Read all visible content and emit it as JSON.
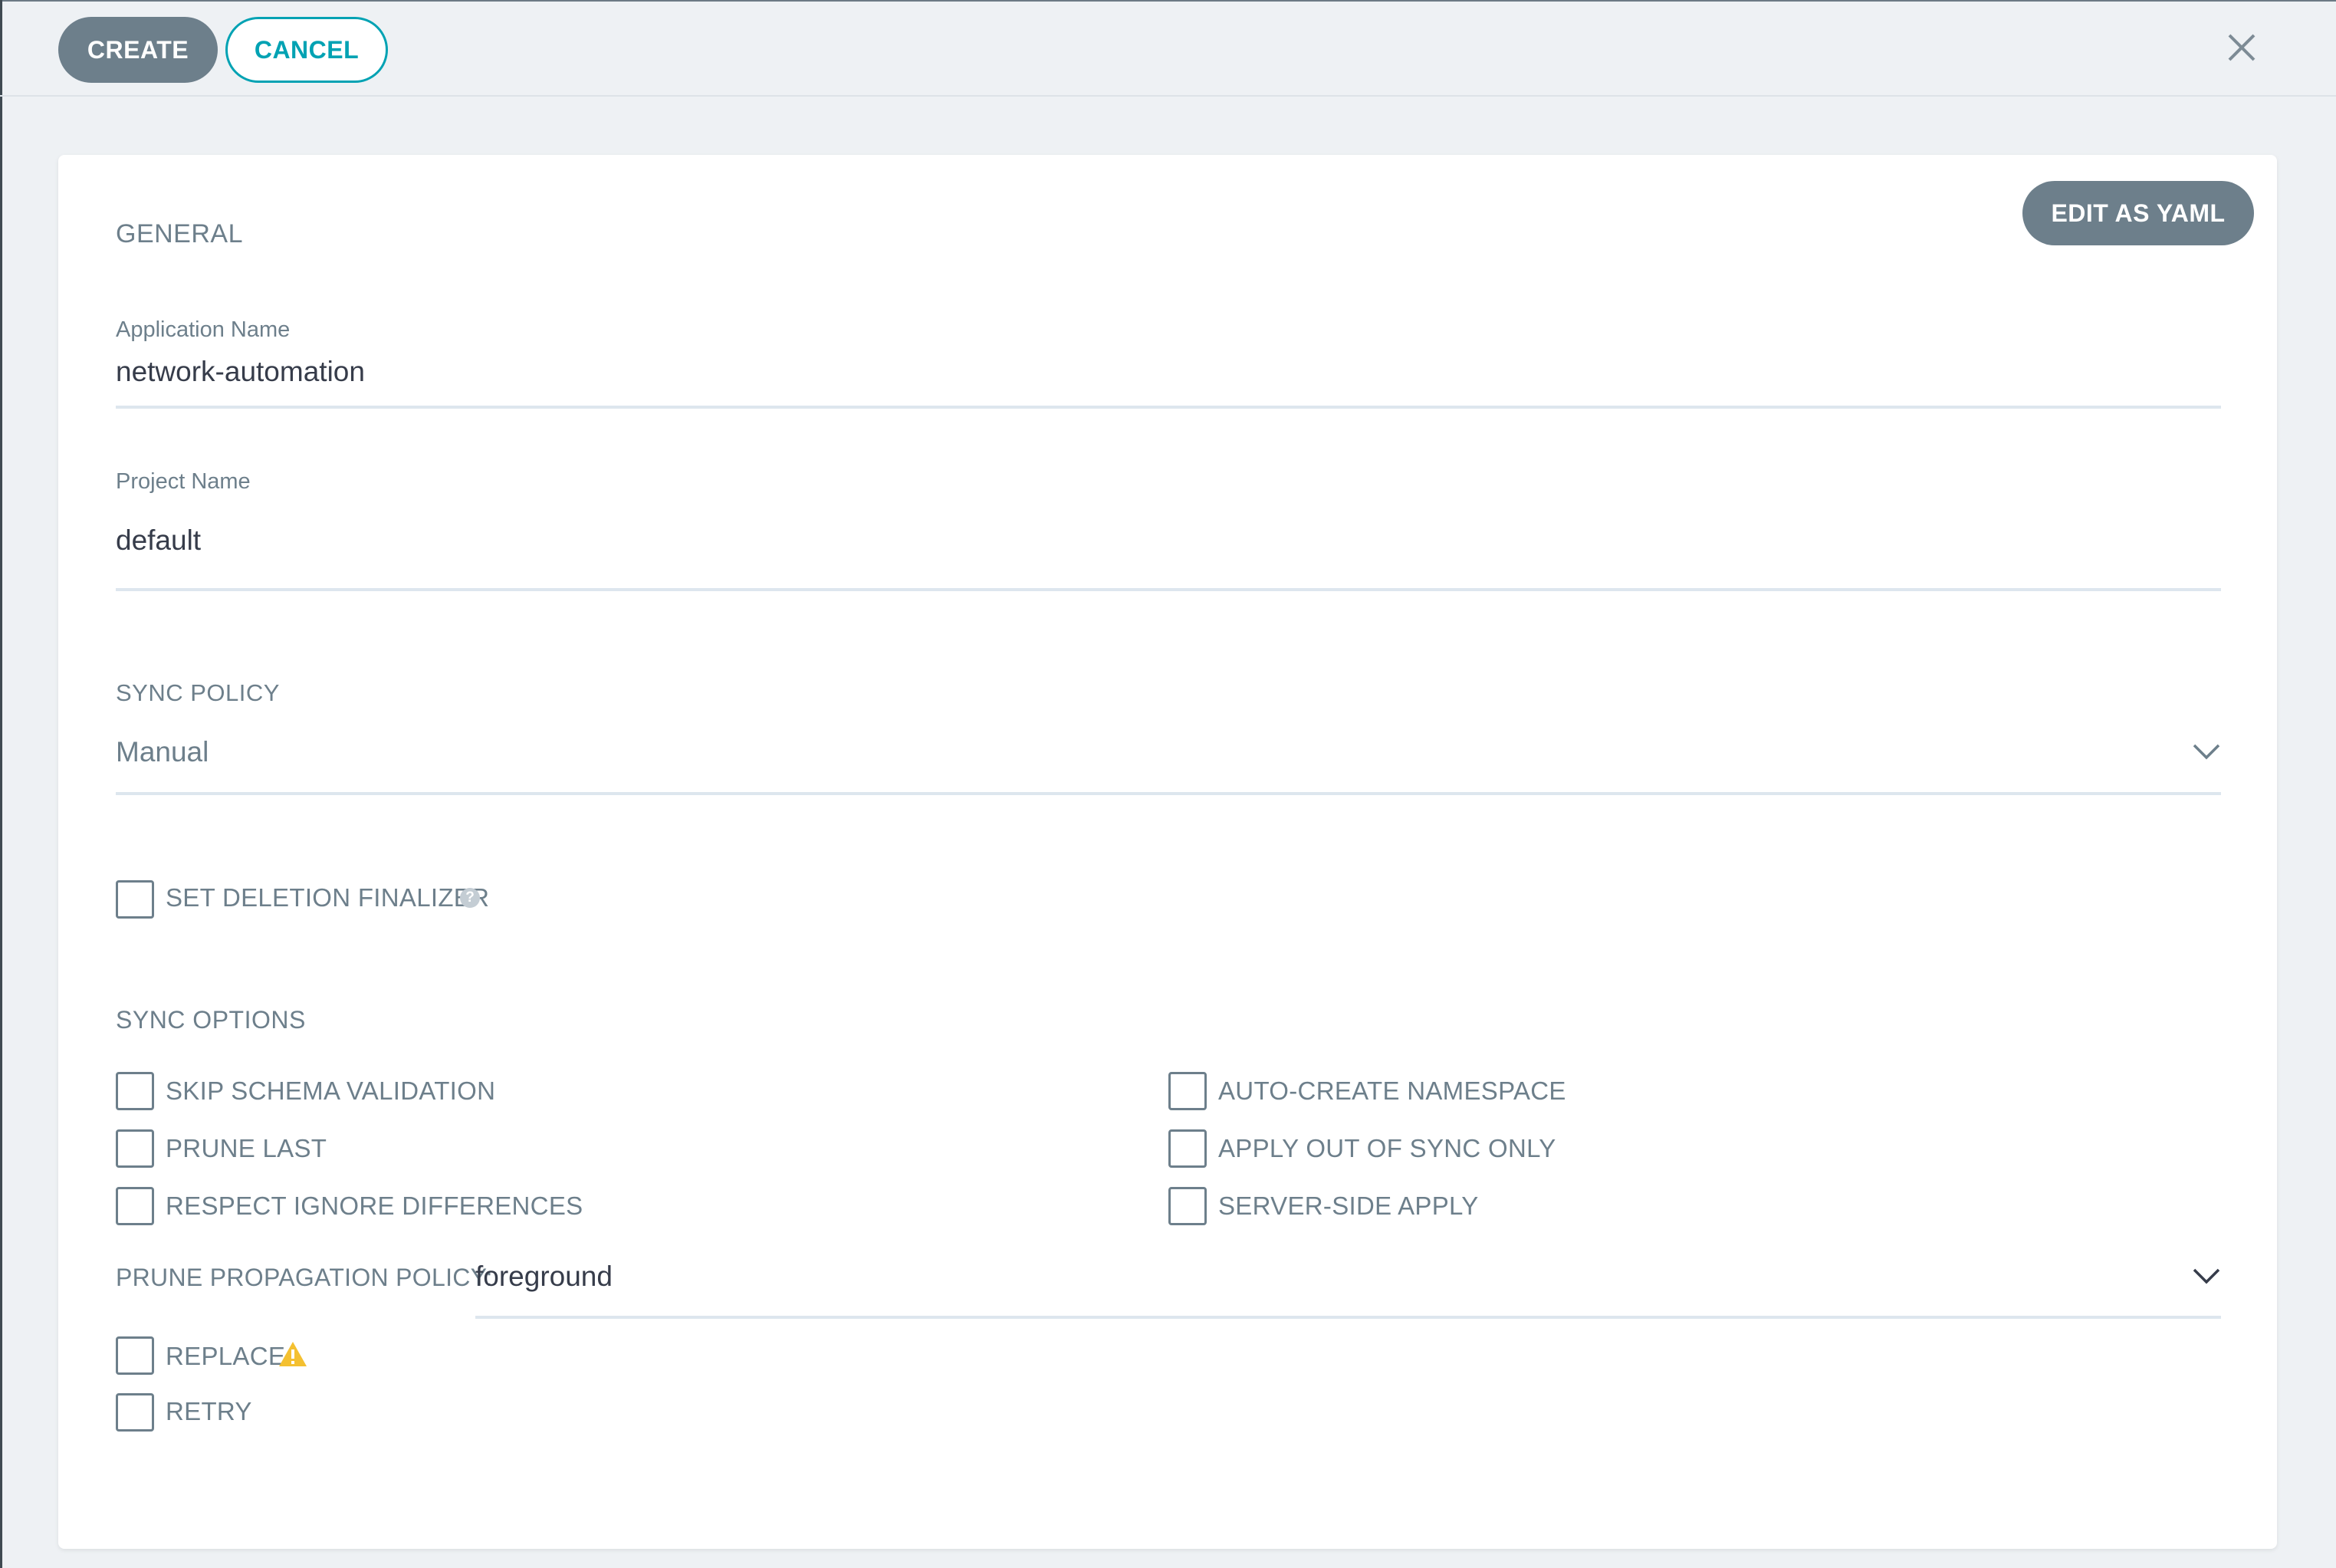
{
  "toolbar": {
    "create_label": "CREATE",
    "cancel_label": "CANCEL",
    "close_icon": "close-icon"
  },
  "card": {
    "edit_yaml_label": "EDIT AS YAML",
    "general": {
      "title": "GENERAL",
      "application_name": {
        "label": "Application Name",
        "value": "network-automation"
      },
      "project_name": {
        "label": "Project Name",
        "value": "default"
      }
    },
    "sync_policy": {
      "title": "SYNC POLICY",
      "value": "Manual"
    },
    "deletion_finalizer": {
      "label": "SET DELETION FINALIZER",
      "checked": false,
      "help_icon": "?"
    },
    "sync_options": {
      "title": "SYNC OPTIONS",
      "left": [
        {
          "label": "SKIP SCHEMA VALIDATION",
          "checked": false
        },
        {
          "label": "PRUNE LAST",
          "checked": false
        },
        {
          "label": "RESPECT IGNORE DIFFERENCES",
          "checked": false
        }
      ],
      "right": [
        {
          "label": "AUTO-CREATE NAMESPACE",
          "checked": false
        },
        {
          "label": "APPLY OUT OF SYNC ONLY",
          "checked": false
        },
        {
          "label": "SERVER-SIDE APPLY",
          "checked": false
        }
      ],
      "prune_propagation": {
        "label": "PRUNE PROPAGATION POLICY:",
        "value": "foreground"
      },
      "replace": {
        "label": "REPLACE",
        "checked": false,
        "icon": "warning-icon"
      },
      "retry": {
        "label": "RETRY",
        "checked": false
      }
    }
  },
  "colors": {
    "accent": "#00a2b3",
    "button_gray": "#6d7f8b",
    "warning": "#f4c030",
    "background": "#eef1f4"
  }
}
